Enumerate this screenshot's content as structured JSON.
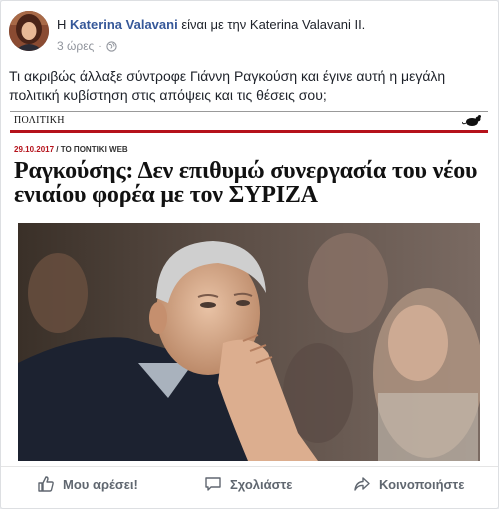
{
  "post": {
    "prefix": "Η",
    "author": "Katerina Valavani",
    "with_text": "είναι με την",
    "tagged": "Katerina Valavani II.",
    "time": "3 ώρες",
    "separator": "·",
    "text": "Τι ακριβώς άλλαξε σύντροφε Γιάννη Ραγκούση και έγινε αυτή η μεγάλη πολιτική κυβίστηση στις απόψεις και τις θέσεις σου;"
  },
  "attachment": {
    "section": "ΠΟΛΙΤΙΚΗ",
    "date": "29.10.2017",
    "source": "/ ΤΟ ΠΟΝΤΙΚΙ WEB",
    "headline": "Ραγκούσης: Δεν επιθυμώ συνεργασία του νέου ενιαίου φορέα με τον ΣΥΡΙΖΑ"
  },
  "actions": {
    "like": "Μου αρέσει!",
    "comment": "Σχολιάστε",
    "share": "Κοινοποιήστε"
  },
  "colors": {
    "link": "#365899",
    "accent_red": "#b5121b",
    "meta": "#90949c",
    "action": "#606770"
  }
}
